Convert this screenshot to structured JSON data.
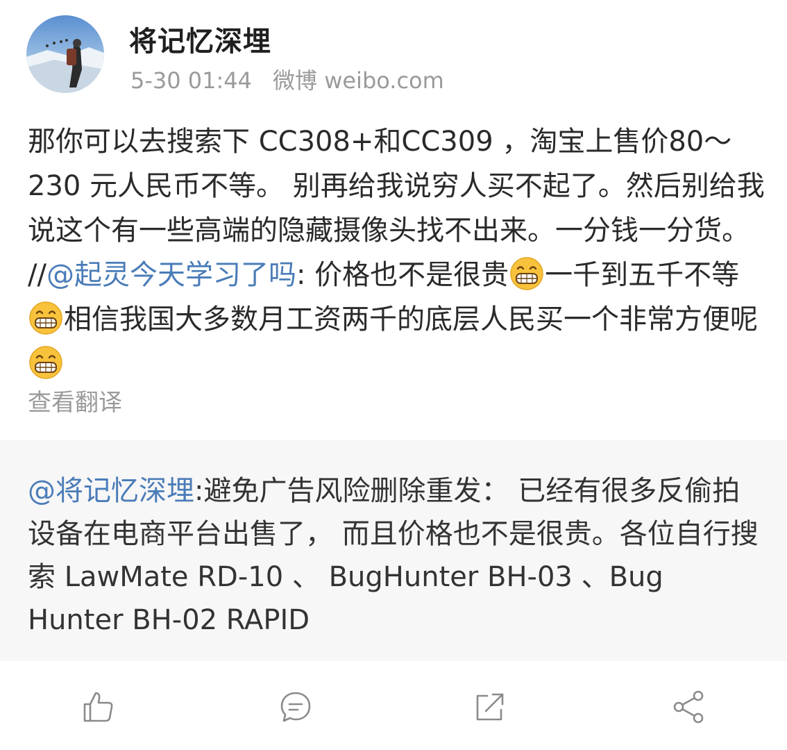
{
  "header": {
    "username": "将记忆深埋",
    "time": "5-30 01:44",
    "source": "微博 weibo.com"
  },
  "post": {
    "text_1": "那你可以去搜索下 CC308+和CC309 ，淘宝上售价80～230 元人民币不等。 别再给我说穷人买不起了。然后别给我说这个有一些高端的隐藏摄像头找不出来。一分钱一分货。 //",
    "mention": "@起灵今天学习了吗",
    "text_2": ": 价格也不是很贵",
    "text_3": "一千到五千不等",
    "text_4": "相信我国大多数月工资两千的底层人民买一个非常方便呢",
    "emoji": "grin-emoji",
    "translate_link": "查看翻译"
  },
  "repost": {
    "mention": "@将记忆深埋",
    "text": ":避免广告风险删除重发： 已经有很多反偷拍设备在电商平台出售了， 而且价格也不是很贵。各位自行搜索 LawMate RD-10 、 BugHunter BH-03 、Bug Hunter BH-02 RAPID"
  },
  "actions": {
    "like": "thumbs-up-icon",
    "comment": "comment-icon",
    "repost": "repost-icon",
    "share": "share-icon"
  },
  "colors": {
    "mention": "#4a7cb8",
    "muted": "#9a9a9a",
    "repost_bg": "#f7f7f7"
  }
}
